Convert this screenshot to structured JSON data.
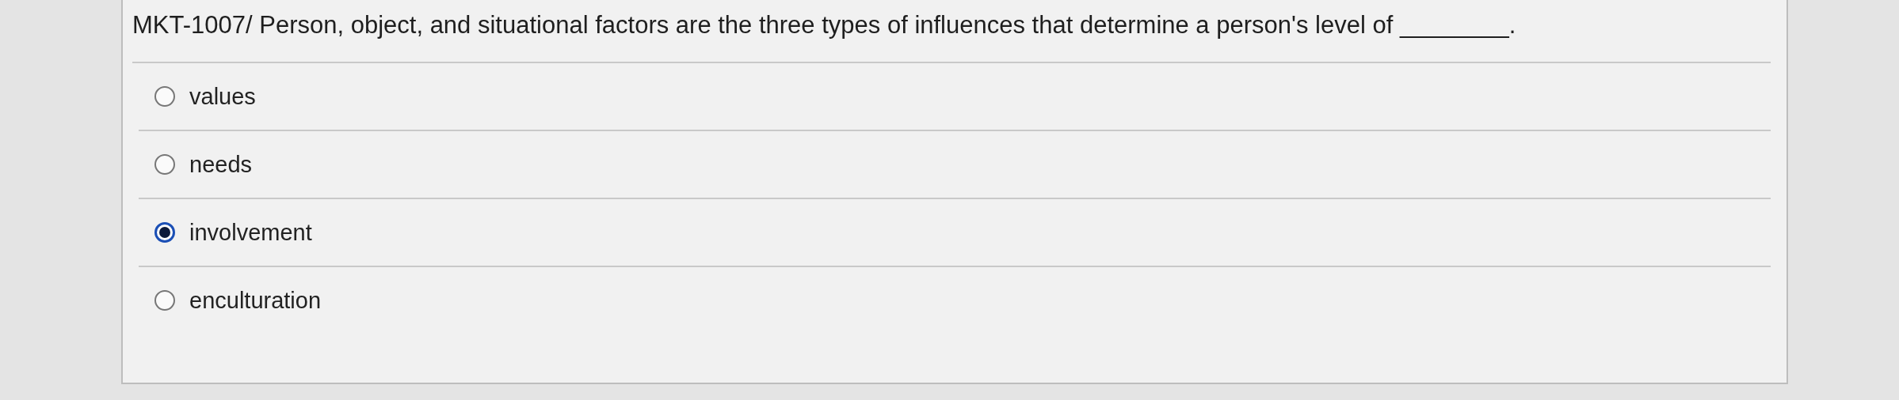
{
  "question": {
    "text": "MKT-1007/ Person, object, and situational factors are the three types of influences that determine a person's level of ________."
  },
  "options": [
    {
      "label": "values",
      "selected": false
    },
    {
      "label": "needs",
      "selected": false
    },
    {
      "label": "involvement",
      "selected": true
    },
    {
      "label": "enculturation",
      "selected": false
    }
  ]
}
